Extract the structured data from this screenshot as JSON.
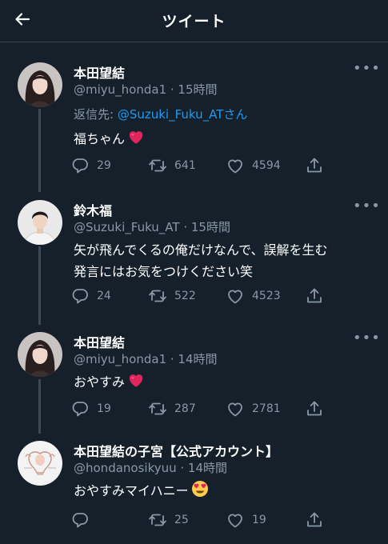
{
  "header": {
    "title": "ツイート"
  },
  "tweets": [
    {
      "name": "本田望結",
      "meta": "@miyu_honda1 · 15時間",
      "reply_prefix": "返信先: ",
      "reply_handle": "@Suzuki_Fuku_AT",
      "reply_suffix": "さん",
      "text": "福ちゃん",
      "emoji": "red-heart",
      "replies": "29",
      "retweets": "641",
      "likes": "4594"
    },
    {
      "name": "鈴木福",
      "meta": "@Suzuki_Fuku_AT · 15時間",
      "text_lines": [
        "矢が飛んでくるの俺だけなんで、誤解を生む",
        "発言にはお気をつけください笑"
      ],
      "replies": "24",
      "retweets": "522",
      "likes": "4523"
    },
    {
      "name": "本田望結",
      "meta": "@miyu_honda1 · 14時間",
      "text": "おやすみ",
      "emoji": "red-heart",
      "replies": "19",
      "retweets": "287",
      "likes": "2781"
    },
    {
      "name": "本田望結の子宮【公式アカウント】",
      "meta": "@hondanosikyuu · 14時間",
      "text": "おやすみマイハニー",
      "emoji": "heart-eyes-face",
      "replies": "",
      "retweets": "25",
      "likes": "19"
    }
  ],
  "colors": {
    "background": "#15202b",
    "text_secondary": "#8899a6",
    "link": "#1d9bf0",
    "heart": "#e0245e"
  }
}
